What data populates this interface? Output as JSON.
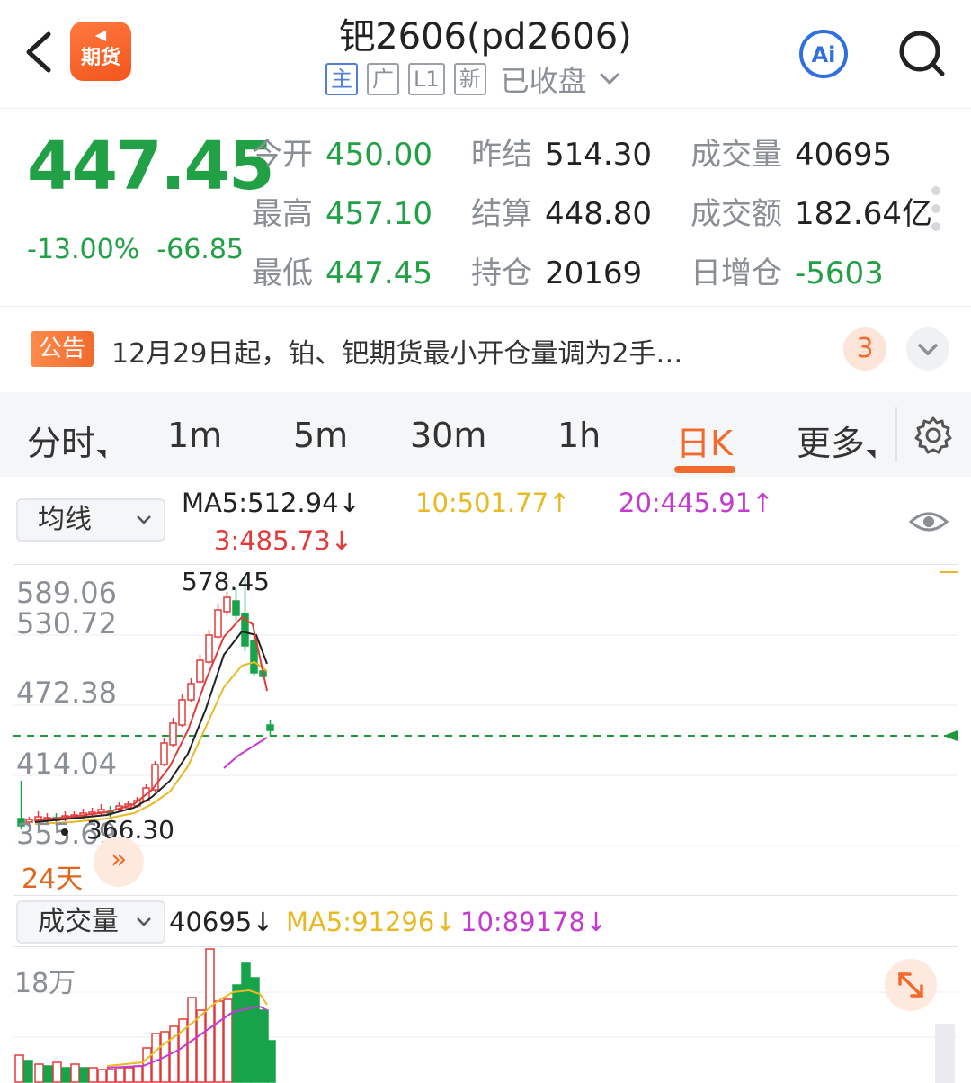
{
  "header": {
    "title": "钯2606(pd2606)",
    "app_logo_top": "◀",
    "app_logo_text": "期货",
    "tags": [
      "主",
      "广",
      "L1",
      "新"
    ],
    "status": "已收盘"
  },
  "quote": {
    "price": "447.45",
    "change_pct": "-13.00%",
    "change_abs": "-66.85",
    "fields": [
      {
        "label": "今开",
        "value": "450.00",
        "color": "green"
      },
      {
        "label": "昨结",
        "value": "514.30",
        "color": "dark"
      },
      {
        "label": "成交量",
        "value": "40695",
        "color": "dark"
      },
      {
        "label": "最高",
        "value": "457.10",
        "color": "green"
      },
      {
        "label": "结算",
        "value": "448.80",
        "color": "dark"
      },
      {
        "label": "成交额",
        "value": "182.64亿",
        "color": "dark"
      },
      {
        "label": "最低",
        "value": "447.45",
        "color": "green"
      },
      {
        "label": "持仓",
        "value": "20169",
        "color": "dark"
      },
      {
        "label": "日增仓",
        "value": "-5603",
        "color": "green"
      }
    ]
  },
  "notice": {
    "badge": "公告",
    "text": "12月29日起，铂、钯期货最小开仓量调为2手…",
    "count": "3"
  },
  "tabs": [
    {
      "label": "分时",
      "has_menu": true
    },
    {
      "label": "1m"
    },
    {
      "label": "5m"
    },
    {
      "label": "30m"
    },
    {
      "label": "1h"
    },
    {
      "label": "日K",
      "active": true
    },
    {
      "label": "更多",
      "has_menu": true
    }
  ],
  "indicators": {
    "selector": "均线",
    "ma5": "MA5:512.94↓",
    "ma10": "10:501.77↑",
    "ma20": "20:445.91↑",
    "ma3": "3:485.73↓"
  },
  "chart": {
    "y_labels": [
      "589.06",
      "530.72",
      "472.38",
      "414.04",
      "355.69"
    ],
    "high_label": "578.45",
    "low_label": "366.30",
    "days_label": "24天",
    "ff_label": "»",
    "colors": {
      "up": "#e23b3b",
      "down": "#16a34a",
      "ma5": "#222222",
      "ma10": "#e8b923",
      "ma20": "#c43bd1",
      "ma3": "#e23b3b",
      "dash": "#1f9a3a"
    }
  },
  "volume": {
    "selector": "成交量",
    "value": "40695↓",
    "ma5": "MA5:91296↓",
    "ma10": "10:89178↓",
    "y_label": "18万"
  }
}
